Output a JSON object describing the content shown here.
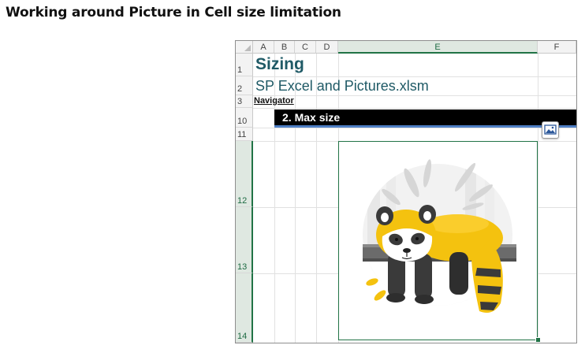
{
  "page_title": "Working around Picture in Cell size limitation",
  "sheet": {
    "columns": [
      "A",
      "B",
      "C",
      "D",
      "E",
      "F"
    ],
    "selected_column": "E",
    "rows": [
      "1",
      "2",
      "3",
      "10",
      "11",
      "12",
      "13",
      "14"
    ],
    "selected_rows": [
      "12",
      "13",
      "14"
    ],
    "cells": {
      "A1": "Sizing",
      "A2": "SP Excel and Pictures.xlsm",
      "A3": "Navigator",
      "B10": "2. Max size"
    },
    "picture_cell_icon": "image-icon",
    "picture_subject": "red-panda-illustration",
    "colors": {
      "selection": "#217346",
      "title_text": "#1f5a66",
      "banner_background": "#000000",
      "banner_underline": "#4f7fc4",
      "panda_accent": "#f4c20f"
    }
  }
}
